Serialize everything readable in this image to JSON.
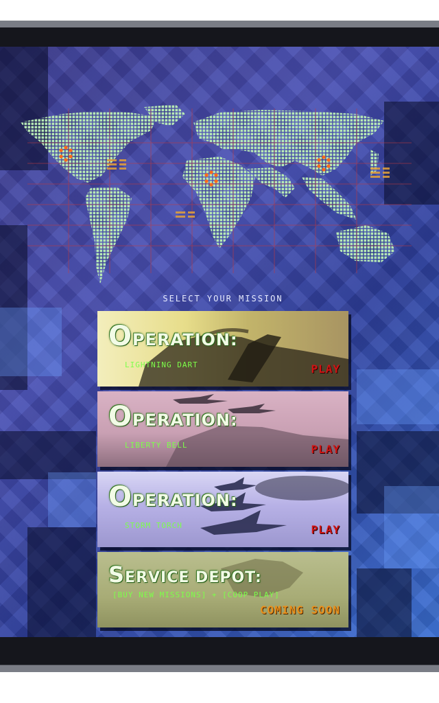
{
  "screen": {
    "tagline": "SELECT YOUR MISSION"
  },
  "missions": [
    {
      "title_cap": "O",
      "title_rest": "PERATION:",
      "name": "LIGHTNING DART",
      "action": "PLAY"
    },
    {
      "title_cap": "O",
      "title_rest": "PERATION:",
      "name": "LIBERTY BELL",
      "action": "PLAY"
    },
    {
      "title_cap": "O",
      "title_rest": "PERATION:",
      "name": "STORM TORCH",
      "action": "PLAY"
    }
  ],
  "service_depot": {
    "title_cap": "S",
    "title_rest": "ERVICE DEPOT:",
    "subtitle": "[BUY NEW MISSIONS] + [COOP PLAY]",
    "action": "COMING SOON"
  },
  "map": {
    "land_color": "#b6e8b4",
    "marker_color": "#ff6a1a",
    "grid_color": "#c2393f",
    "markers": [
      "north-america-marker",
      "north-africa-marker",
      "east-asia-marker"
    ]
  },
  "colors": {
    "play": "#d01414",
    "coming_soon": "#e8901c",
    "subtitle": "#7cff4a"
  }
}
